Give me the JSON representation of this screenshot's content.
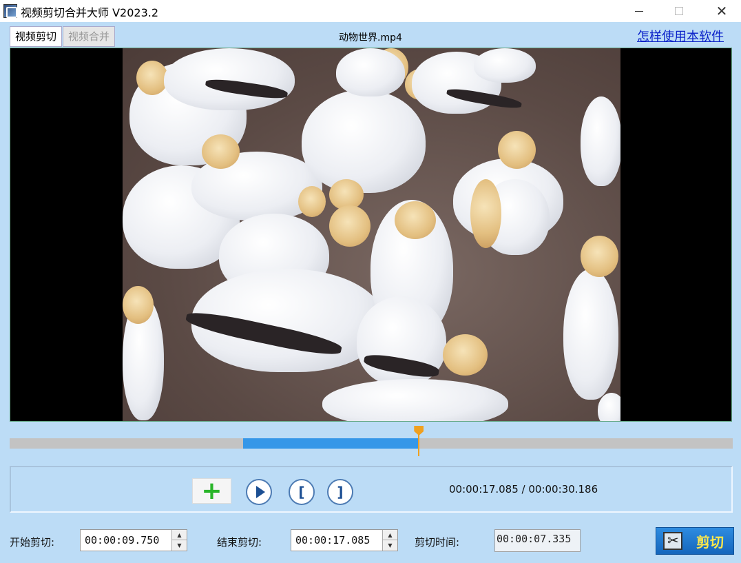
{
  "window": {
    "title": "视频剪切合并大师 V2023.2"
  },
  "tabs": [
    {
      "label": "视频剪切",
      "active": true
    },
    {
      "label": "视频合并",
      "active": false
    }
  ],
  "video": {
    "file_name": "动物世界.mp4"
  },
  "help_link": "怎样使用本软件",
  "timeline": {
    "selection_start": 0.323,
    "selection_end": 0.566,
    "playhead": 0.566
  },
  "player": {
    "current_time": "00:00:17.085",
    "total_time": "00:00:30.186",
    "time_separator": " / ",
    "mark_in_glyph": "[",
    "mark_out_glyph": "]",
    "add_glyph": "+"
  },
  "cut": {
    "start_label": "开始剪切:",
    "start_value": "00:00:09.750",
    "end_label": "结束剪切:",
    "end_value": "00:00:17.085",
    "duration_label": "剪切时间:",
    "duration_value": "00:00:07.335",
    "button_label": "剪切"
  },
  "colors": {
    "background": "#bcdcf6",
    "selection": "#3597e8",
    "playhead": "#f0a020",
    "link": "#0b22c9"
  }
}
